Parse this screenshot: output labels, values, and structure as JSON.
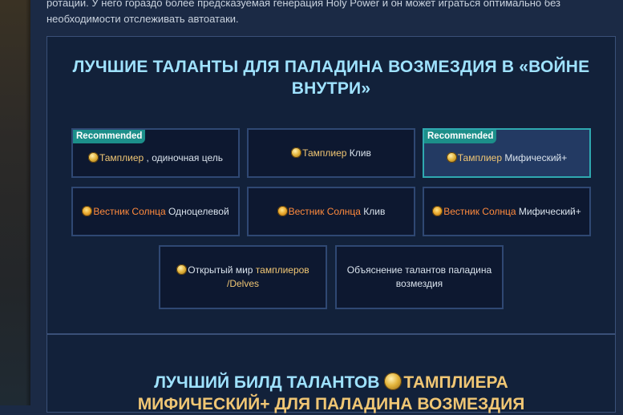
{
  "intro": {
    "text": "ротации. У него гораздо более предсказуемая генерация Holy Power и он может играться оптимально без необходимости отслеживать автоатаки."
  },
  "panel": {
    "title": "ЛУЧШИЕ ТАЛАНТЫ ДЛЯ ПАЛАДИНА ВОЗМЕЗДИЯ В «ВОЙНЕ ВНУТРИ»"
  },
  "badge_text": "Recommended",
  "cards": [
    {
      "highlight": "Тамплиер",
      "rest": " , одиночная цель",
      "icon": "templar-icon",
      "recommended": true
    },
    {
      "highlight": "Тамплиер",
      "rest": " Клив",
      "icon": "templar-icon",
      "recommended": false
    },
    {
      "highlight": "Тамплиер",
      "rest": " Мифический+",
      "icon": "templar-icon",
      "recommended": true
    },
    {
      "highlight": "Вестник Солнца",
      "rest": " Одноцелевой",
      "icon": "herald-of-the-sun-icon",
      "recommended": false
    },
    {
      "highlight": "Вестник Солнца",
      "rest": " Клив",
      "icon": "herald-of-the-sun-icon",
      "recommended": false
    },
    {
      "highlight": "Вестник Солнца",
      "rest": " Мифический+",
      "icon": "herald-of-the-sun-icon",
      "recommended": false
    },
    {
      "pre": "Открытый мир ",
      "highlight": "тамплиеров /Delves",
      "icon": "templar-icon"
    },
    {
      "text": "Объяснение талантов паладина возмездия"
    }
  ],
  "section2": {
    "title_pre": "ЛУЧШИЙ БИЛД ТАЛАНТОВ",
    "title_highlight": "ТАМПЛИЕРА",
    "title_rest": "МИФИЧЕСКИЙ+ ДЛЯ ПАЛАДИНА ВОЗМЕЗДИЯ"
  },
  "colors": {
    "accent_title": "#9fe2ff",
    "templar_gold": "#f0c674",
    "herald_orange": "#ff8a3d",
    "badge_teal": "#1c8f8a",
    "active_border": "#2fa9b0"
  }
}
